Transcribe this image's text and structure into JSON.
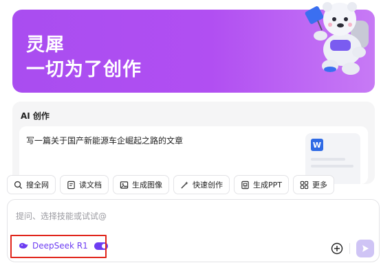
{
  "hero": {
    "title_line1": "灵犀",
    "title_line2": "一切为了创作"
  },
  "ai_section": {
    "label": "AI 创作",
    "prompt": "写一篇关于国产新能源车企崛起之路的文章",
    "doc_icon_letter": "W"
  },
  "skills": [
    {
      "label": "搜全网",
      "icon": "search-web-icon"
    },
    {
      "label": "读文档",
      "icon": "read-doc-icon"
    },
    {
      "label": "生成图像",
      "icon": "image-icon"
    },
    {
      "label": "快速创作",
      "icon": "magic-icon"
    },
    {
      "label": "生成PPT",
      "icon": "ppt-icon"
    },
    {
      "label": "更多",
      "icon": "grid-icon"
    }
  ],
  "input": {
    "placeholder": "提问、选择技能或试试@",
    "value": ""
  },
  "deepseek": {
    "label": "DeepSeek R1",
    "enabled": true
  },
  "colors": {
    "hero_gradient_start": "#a94df0",
    "hero_gradient_end": "#c77af5",
    "accent": "#6d3df2",
    "highlight": "#e0251b",
    "send_disabled": "#cfc4f5"
  }
}
